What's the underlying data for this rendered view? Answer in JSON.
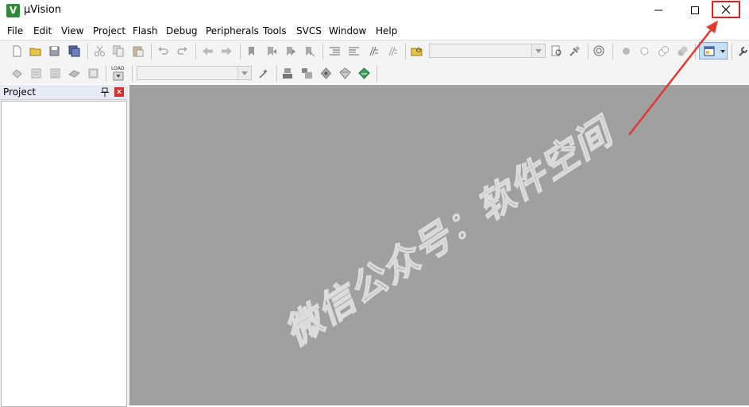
{
  "window": {
    "title": "µVision",
    "logo_letter": "V",
    "minimize_icon": "minimize-icon",
    "maximize_icon": "maximize-icon",
    "close_icon": "close-icon"
  },
  "menu": [
    "File",
    "Edit",
    "View",
    "Project",
    "Flash",
    "Debug",
    "Peripherals",
    "Tools",
    "SVCS",
    "Window",
    "Help"
  ],
  "toolbar1": {
    "icons": [
      "new-file-icon",
      "open-folder-icon",
      "save-icon",
      "save-all-icon",
      "cut-icon",
      "copy-icon",
      "paste-icon",
      "undo-icon",
      "redo-icon",
      "nav-back-icon",
      "nav-forward-icon",
      "bookmark-insert-icon",
      "bookmark-prev-icon",
      "bookmark-next-icon",
      "bookmark-clear-icon",
      "indent-icon",
      "unindent-icon",
      "comment-icon",
      "uncomment-icon",
      "find-in-files-icon",
      "find-icon",
      "incremental-find-icon",
      "debug-session-icon",
      "breakpoint-insert-icon",
      "breakpoint-enable-icon",
      "breakpoint-disable-icon",
      "breakpoint-kill-icon",
      "window-layout-icon",
      "configure-icon"
    ],
    "find_combo_value": ""
  },
  "toolbar2": {
    "icons": [
      "translate-icon",
      "build-icon",
      "rebuild-icon",
      "batch-build-icon",
      "stop-build-icon",
      "download-icon",
      "target-options-icon",
      "manage-project-icon",
      "manage-components-icon",
      "select-packs-icon",
      "pack-installer-icon",
      "run-time-env-icon"
    ],
    "load_label": "LOAD",
    "target_combo_value": ""
  },
  "project_panel": {
    "title": "Project",
    "pin_icon": "pin-icon",
    "close_label": "x"
  },
  "workspace": {
    "watermark": "微信公众号：软件空间"
  },
  "colors": {
    "workspace_bg": "#a0a0a0",
    "highlight": "#e02020",
    "panel_header": "#e6eaf2"
  }
}
